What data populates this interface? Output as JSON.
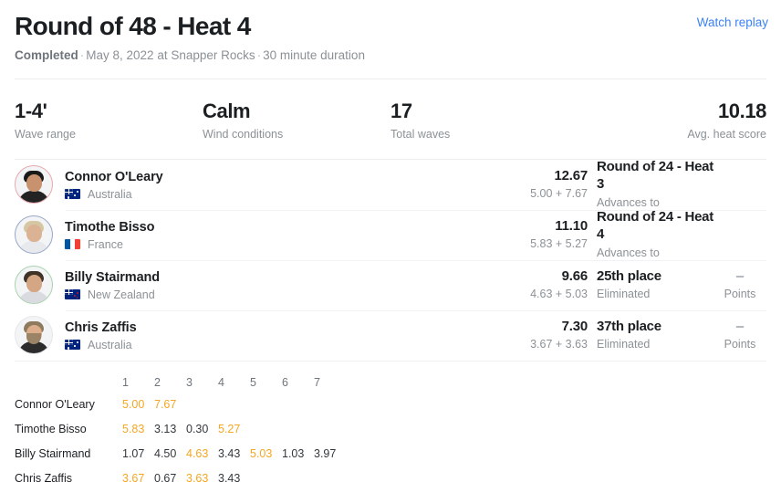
{
  "header": {
    "title": "Round of 48 - Heat 4",
    "status": "Completed",
    "separator": "·",
    "date_location": "May 8, 2022 at Snapper Rocks",
    "duration": "30 minute duration",
    "watch_replay_label": "Watch replay",
    "link_color": "#3b82f6"
  },
  "stats": [
    {
      "value": "1-4'",
      "label": "Wave range",
      "name": "wave-range"
    },
    {
      "value": "Calm",
      "label": "Wind conditions",
      "name": "wind-conditions"
    },
    {
      "value": "17",
      "label": "Total waves",
      "name": "total-waves"
    },
    {
      "value": "10.18",
      "label": "Avg. heat score",
      "name": "avg-heat-score"
    }
  ],
  "surfers": [
    {
      "name": "Connor O'Leary",
      "country": "Australia",
      "flag": "au-flag-icon",
      "ring_color": "#e8a9ae",
      "total": "12.67",
      "breakdown": "5.00 + 7.67",
      "outcome": "Round of 24 - Heat 3",
      "outcome_label": "Advances to",
      "points": "",
      "points_label": ""
    },
    {
      "name": "Timothe Bisso",
      "country": "France",
      "flag": "fr-flag-icon",
      "ring_color": "#98a7c8",
      "total": "11.10",
      "breakdown": "5.83 + 5.27",
      "outcome": "Round of 24 - Heat 4",
      "outcome_label": "Advances to",
      "points": "",
      "points_label": ""
    },
    {
      "name": "Billy Stairmand",
      "country": "New Zealand",
      "flag": "nz-flag-icon",
      "ring_color": "#a9d3ae",
      "total": "9.66",
      "breakdown": "4.63 + 5.03",
      "outcome": "25th place",
      "outcome_label": "Eliminated",
      "points": "–",
      "points_label": "Points"
    },
    {
      "name": "Chris Zaffis",
      "country": "Australia",
      "flag": "au-flag-icon",
      "ring_color": "#e6e7ea",
      "total": "7.30",
      "breakdown": "3.67 + 3.63",
      "outcome": "37th place",
      "outcome_label": "Eliminated",
      "points": "–",
      "points_label": "Points"
    }
  ],
  "wave_table": {
    "columns": [
      "1",
      "2",
      "3",
      "4",
      "5",
      "6",
      "7"
    ],
    "counted_color": "#f5a623",
    "rows": [
      {
        "name": "Connor O'Leary",
        "scores": [
          "5.00",
          "7.67",
          "",
          "",
          "",
          "",
          ""
        ],
        "counted": [
          true,
          true,
          false,
          false,
          false,
          false,
          false
        ]
      },
      {
        "name": "Timothe Bisso",
        "scores": [
          "5.83",
          "3.13",
          "0.30",
          "5.27",
          "",
          "",
          ""
        ],
        "counted": [
          true,
          false,
          false,
          true,
          false,
          false,
          false
        ]
      },
      {
        "name": "Billy Stairmand",
        "scores": [
          "1.07",
          "4.50",
          "4.63",
          "3.43",
          "5.03",
          "1.03",
          "3.97"
        ],
        "counted": [
          false,
          false,
          true,
          false,
          true,
          false,
          false
        ]
      },
      {
        "name": "Chris Zaffis",
        "scores": [
          "3.67",
          "0.67",
          "3.63",
          "3.43",
          "",
          "",
          ""
        ],
        "counted": [
          true,
          false,
          true,
          false,
          false,
          false,
          false
        ]
      }
    ]
  }
}
